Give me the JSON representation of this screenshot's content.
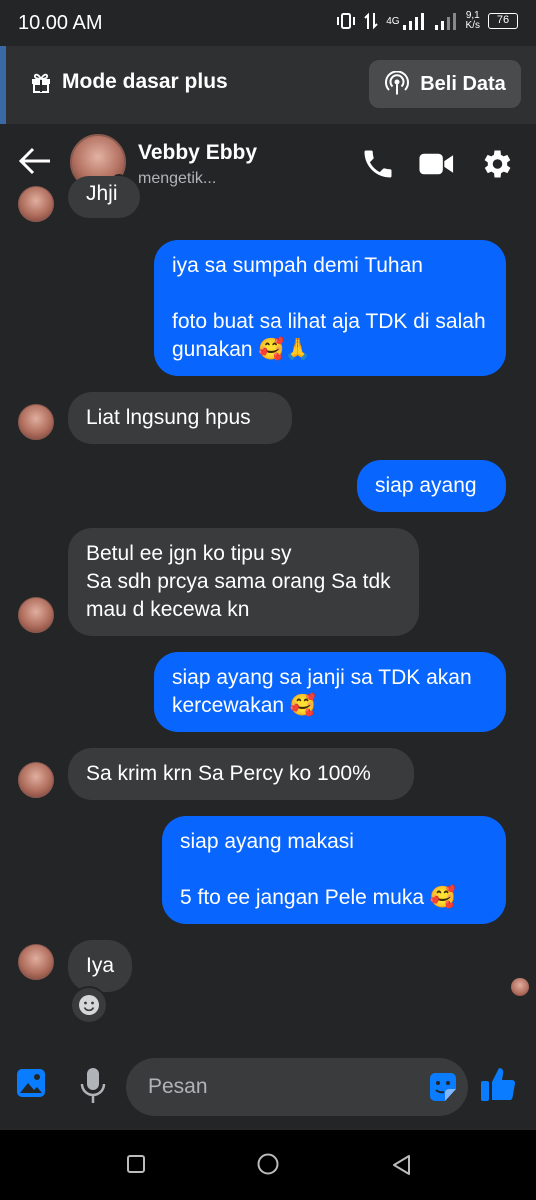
{
  "status_bar": {
    "time": "10.00 AM",
    "network": "4G",
    "speed_value": "9,1",
    "speed_unit": "K/s",
    "battery": "76"
  },
  "banner": {
    "mode_label": "Mode dasar plus",
    "buy_label": "Beli Data"
  },
  "header": {
    "name": "Vebby Ebby",
    "status": "mengetik..."
  },
  "messages": [
    {
      "from": "them",
      "text": "Jhji"
    },
    {
      "from": "me",
      "text": "iya sa sumpah demi Tuhan\n\nfoto buat sa lihat aja TDK di salah gunakan 🥰🙏"
    },
    {
      "from": "them",
      "text": "Liat lngsung hpus"
    },
    {
      "from": "me",
      "text": "siap ayang"
    },
    {
      "from": "them",
      "text": "Betul ee jgn ko tipu sy\nSa sdh prcya sama orang Sa tdk mau d kecewa kn"
    },
    {
      "from": "me",
      "text": "siap ayang sa janji sa TDK akan kercewakan 🥰"
    },
    {
      "from": "them",
      "text": "Sa krim krn Sa Percy ko 100%"
    },
    {
      "from": "me",
      "text": "siap ayang makasi\n\n5 fto ee jangan Pele muka 🥰"
    },
    {
      "from": "them",
      "text": "Iya"
    }
  ],
  "composer": {
    "placeholder": "Pesan"
  },
  "colors": {
    "background": "#242526",
    "outgoing_bubble": "#0866ff",
    "incoming_bubble": "#3a3b3c",
    "accent": "#0a7cff",
    "online": "#31a24c"
  }
}
